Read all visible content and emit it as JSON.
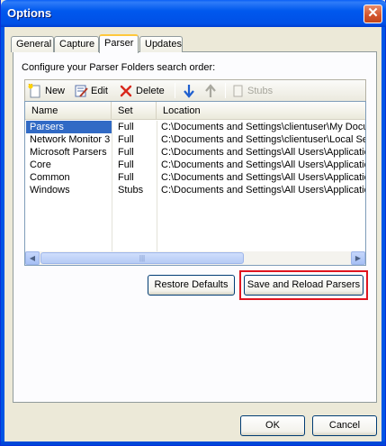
{
  "window": {
    "title": "Options",
    "close_glyph": "✕"
  },
  "tabs": [
    {
      "label": "General"
    },
    {
      "label": "Capture"
    },
    {
      "label": "Parser"
    },
    {
      "label": "Updates"
    }
  ],
  "active_tab": "Parser",
  "section_label": "Configure your Parser Folders search order:",
  "toolbar": {
    "new_label": "New",
    "edit_label": "Edit",
    "delete_label": "Delete",
    "stubs_label": "Stubs"
  },
  "grid": {
    "columns": [
      "Name",
      "Set",
      "Location"
    ],
    "rows": [
      {
        "name": "Parsers",
        "set": "Full",
        "location": "C:\\Documents and Settings\\clientuser\\My Documents",
        "selected": true
      },
      {
        "name": "Network Monitor 3",
        "set": "Full",
        "location": "C:\\Documents and Settings\\clientuser\\Local Settings",
        "selected": false
      },
      {
        "name": "Microsoft Parsers",
        "set": "Full",
        "location": "C:\\Documents and Settings\\All Users\\Application Data",
        "selected": false
      },
      {
        "name": "Core",
        "set": "Full",
        "location": "C:\\Documents and Settings\\All Users\\Application Data",
        "selected": false
      },
      {
        "name": "Common",
        "set": "Full",
        "location": "C:\\Documents and Settings\\All Users\\Application Data",
        "selected": false
      },
      {
        "name": "Windows",
        "set": "Stubs",
        "location": "C:\\Documents and Settings\\All Users\\Application Data",
        "selected": false
      }
    ]
  },
  "buttons": {
    "restore_defaults": "Restore Defaults",
    "save_reload": "Save and Reload Parsers",
    "ok": "OK",
    "cancel": "Cancel"
  },
  "colors": {
    "selection": "#316ac5",
    "highlight": "#e0141e",
    "title_bar": "#0058ee"
  }
}
